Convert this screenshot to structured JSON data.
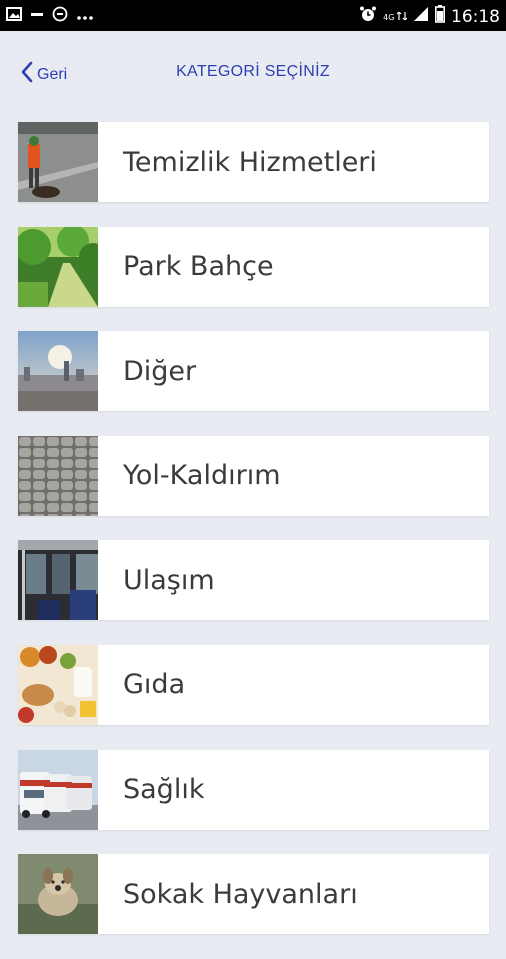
{
  "status_bar": {
    "time": "16:18",
    "network_label": "4G",
    "left_icons": [
      "image-icon",
      "minus-icon",
      "circle-icon",
      "more-dots-icon"
    ],
    "right_icons": [
      "alarm-icon",
      "network-icon",
      "signal-icon",
      "battery-icon"
    ]
  },
  "header": {
    "back_label": "Geri",
    "title": "KATEGORİ SEÇİNİZ",
    "accent_color": "#2d3fb3"
  },
  "categories": [
    {
      "label": "Temizlik Hizmetleri",
      "image": "street-sweeper-photo"
    },
    {
      "label": "Park Bahçe",
      "image": "park-path-photo"
    },
    {
      "label": "Diğer",
      "image": "city-skyline-photo"
    },
    {
      "label": "Yol-Kaldırım",
      "image": "cobblestone-photo"
    },
    {
      "label": "Ulaşım",
      "image": "bus-interior-photo"
    },
    {
      "label": "Gıda",
      "image": "food-produce-photo"
    },
    {
      "label": "Sağlık",
      "image": "ambulances-photo"
    },
    {
      "label": "Sokak Hayvanları",
      "image": "stray-dog-photo"
    }
  ]
}
